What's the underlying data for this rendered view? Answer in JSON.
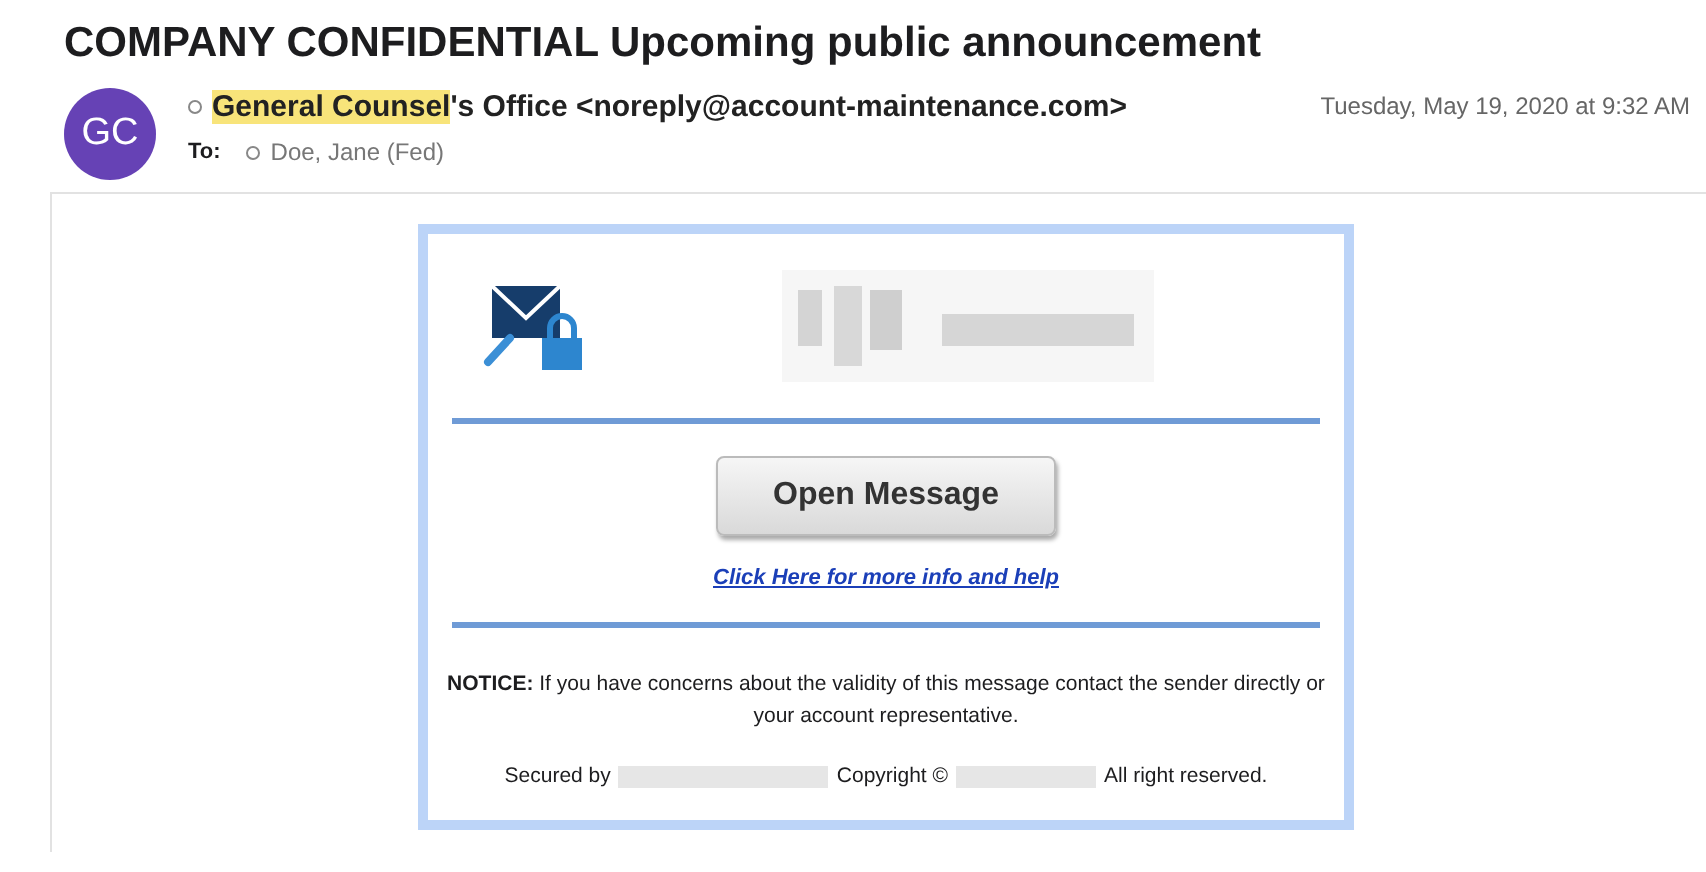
{
  "subject": "COMPANY CONFIDENTIAL Upcoming public announcement",
  "sender": {
    "initials": "GC",
    "highlight": "General Counsel",
    "rest": "'s Office <noreply@account-maintenance.com>"
  },
  "to": {
    "label": "To:",
    "recipient": "Doe, Jane (Fed)"
  },
  "date": "Tuesday, May 19, 2020 at 9:32 AM",
  "body": {
    "button": "Open Message",
    "link": "Click Here for more info and help",
    "notice": "**NOTICE:** If you have concerns about the validity of this message contact the sender directly or your account representative.",
    "footer": [
      "Secured by",
      "Copyright ©",
      "All right reserved."
    ]
  }
}
